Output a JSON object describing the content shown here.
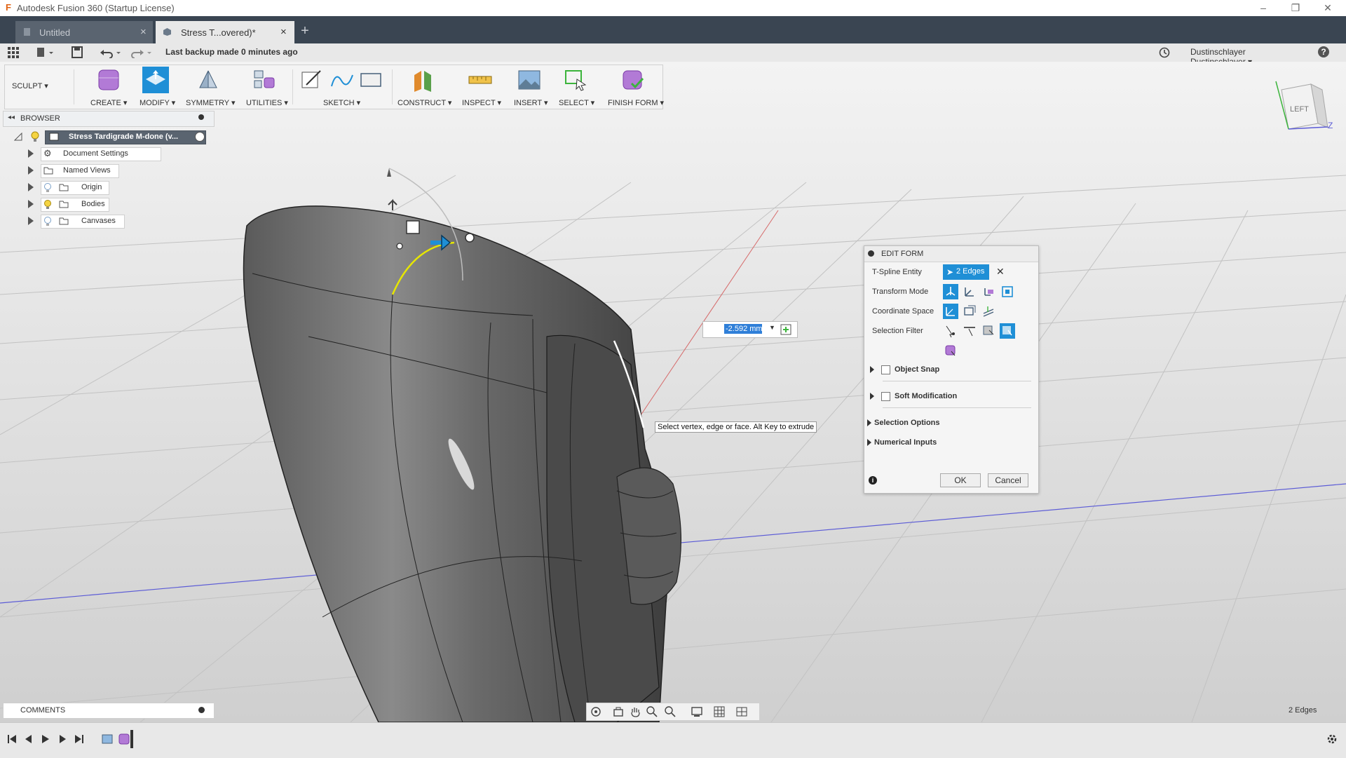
{
  "window": {
    "title": "Autodesk Fusion 360 (Startup License)",
    "app_icon": "fusion-logo-icon",
    "controls": [
      "minimize-icon",
      "restore-icon",
      "close-icon"
    ]
  },
  "tabs": [
    {
      "label": "Untitled",
      "icon": "document-icon",
      "active": false,
      "close": "×"
    },
    {
      "label": "Stress T...overed)*",
      "icon": "cube-icon",
      "active": true,
      "close": "×"
    }
  ],
  "new_tab": "+",
  "quick_access": {
    "backup_text": "Last backup made 0 minutes ago",
    "user_name": "Dustinschlayer Dustinschlayer ▾",
    "help": "?"
  },
  "toolbar": {
    "workspace": "SCULPT ▾",
    "groups": [
      {
        "label": "CREATE ▾",
        "icon": "create-form-icon"
      },
      {
        "label": "MODIFY ▾",
        "icon": "edit-form-icon"
      },
      {
        "label": "SYMMETRY ▾",
        "icon": "symmetry-icon"
      },
      {
        "label": "UTILITIES ▾",
        "icon": "utilities-icon"
      },
      {
        "label": "SKETCH ▾",
        "icon": "sketch-icon"
      },
      {
        "label": "CONSTRUCT ▾",
        "icon": "construct-plane-icon"
      },
      {
        "label": "INSPECT ▾",
        "icon": "measure-icon"
      },
      {
        "label": "INSERT ▾",
        "icon": "insert-image-icon"
      },
      {
        "label": "SELECT ▾",
        "icon": "select-icon"
      },
      {
        "label": "FINISH FORM ▾",
        "icon": "finish-form-icon"
      }
    ]
  },
  "browser": {
    "title": "BROWSER",
    "root": "Stress Tardigrade M-done (v...",
    "items": [
      {
        "label": "Document Settings",
        "icon": "gear-icon"
      },
      {
        "label": "Named Views",
        "icon": "folder-icon"
      },
      {
        "label": "Origin",
        "icon": "folder-icon"
      },
      {
        "label": "Bodies",
        "icon": "folder-icon"
      },
      {
        "label": "Canvases",
        "icon": "folder-icon"
      }
    ]
  },
  "viewcube": {
    "face": "LEFT",
    "axis_z": "Z"
  },
  "value_input": {
    "value": "-2.592 mm"
  },
  "tooltip": "Select vertex, edge or face. Alt Key to extrude",
  "edit_form": {
    "title": "EDIT FORM",
    "entity_label": "T-Spline Entity",
    "entity_value": "2 Edges",
    "transform_mode_label": "Transform Mode",
    "coordinate_space_label": "Coordinate Space",
    "selection_filter_label": "Selection Filter",
    "object_snap": "Object Snap",
    "soft_modification": "Soft Modification",
    "selection_options": "Selection Options",
    "numerical_inputs": "Numerical Inputs",
    "ok": "OK",
    "cancel": "Cancel"
  },
  "comments": {
    "title": "COMMENTS"
  },
  "status_selection": "2 Edges",
  "colors": {
    "accent": "#1f8fd6",
    "tab_bar": "#3a4552",
    "selection_edge": "#e6e600"
  }
}
